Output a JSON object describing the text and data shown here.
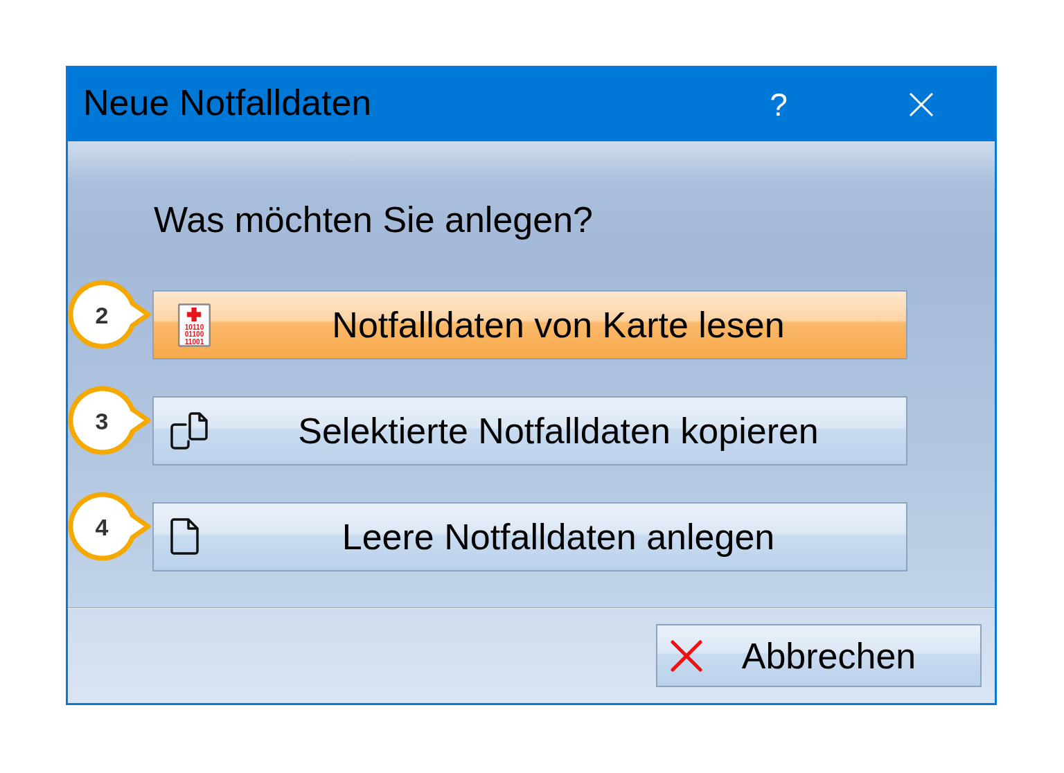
{
  "window": {
    "title": "Neue Notfalldaten",
    "help_label": "?"
  },
  "prompt": "Was möchten Sie anlegen?",
  "options": [
    {
      "kind": "card",
      "label": "Notfalldaten von Karte lesen",
      "callout": "2",
      "selected": true,
      "card_text": [
        "10110",
        "01100",
        "11001"
      ]
    },
    {
      "kind": "copy",
      "label": "Selektierte Notfalldaten kopieren",
      "callout": "3",
      "selected": false
    },
    {
      "kind": "new",
      "label": "Leere Notfalldaten anlegen",
      "callout": "4",
      "selected": false
    }
  ],
  "footer": {
    "cancel_label": "Abbrechen"
  }
}
